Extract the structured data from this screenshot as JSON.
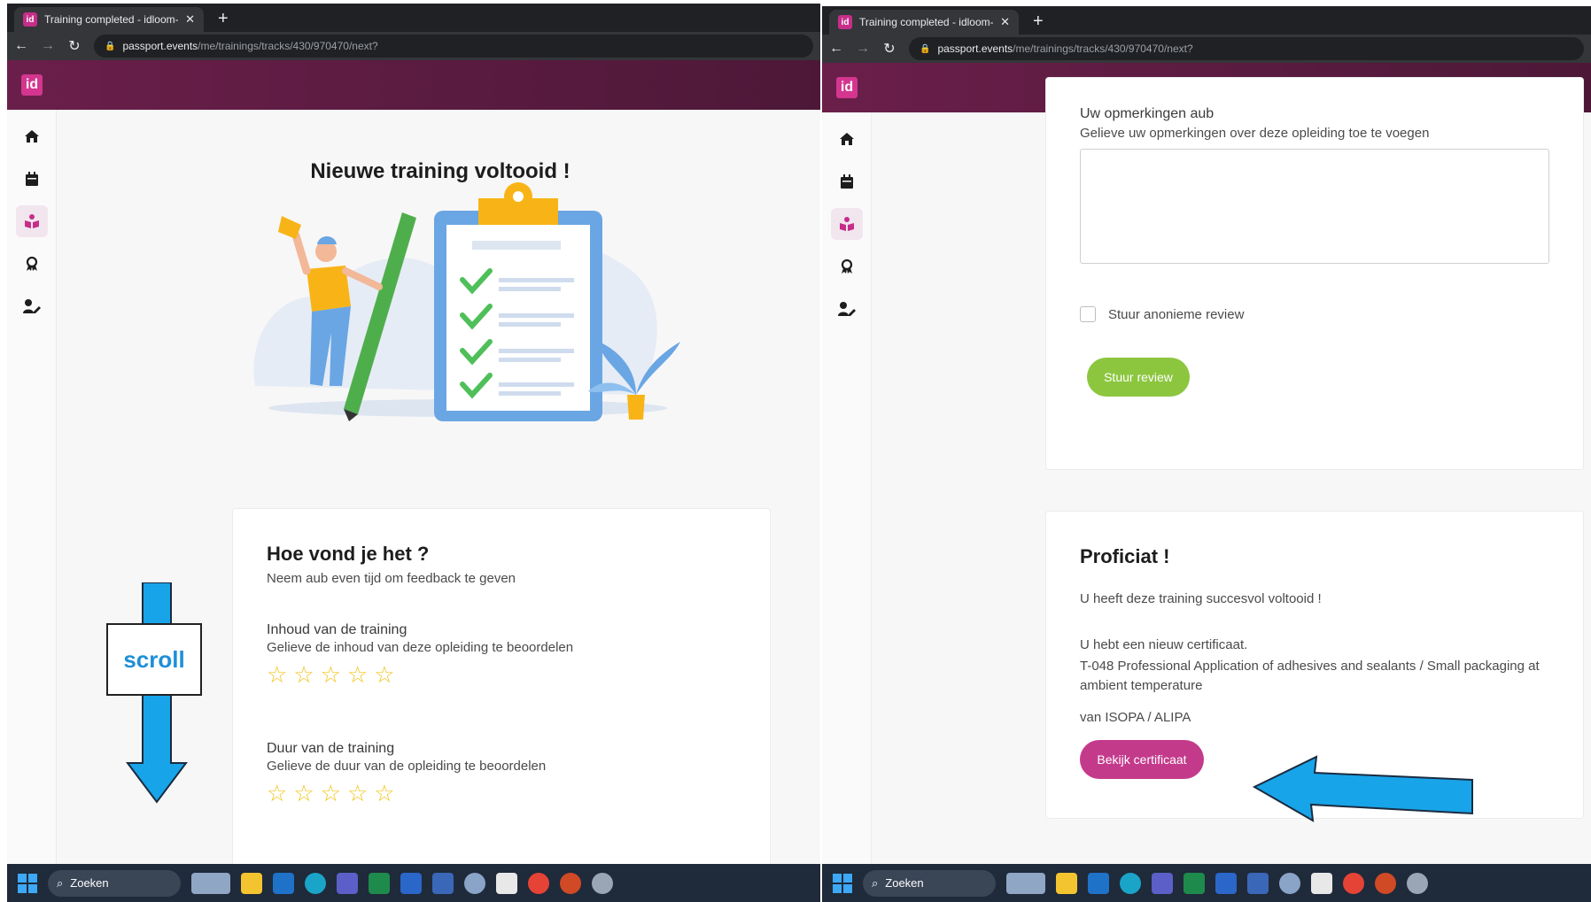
{
  "browser": {
    "tab_title": "Training completed - idloom-pas",
    "favicon_text": "id",
    "new_tab": "+",
    "close": "✕",
    "url_host": "passport.events",
    "url_path": "/me/trainings/tracks/430/970470/next?"
  },
  "app": {
    "logo_text": "id",
    "brand_color": "#c62e8a"
  },
  "left": {
    "heading": "Nieuwe training voltooid !",
    "feedback": {
      "title": "Hoe vond je het ?",
      "subtitle": "Neem aub even tijd om feedback te geven",
      "q1_label": "Inhoud van de training",
      "q1_help": "Gelieve de inhoud van deze opleiding te beoordelen",
      "q2_label": "Duur van de training",
      "q2_help": "Gelieve de duur van de opleiding te beoordelen",
      "stars": [
        "☆",
        "☆",
        "☆",
        "☆",
        "☆"
      ]
    },
    "annotation": "scroll"
  },
  "right": {
    "remarks_label": "Uw opmerkingen aub",
    "remarks_help": "Gelieve uw opmerkingen over deze opleiding toe te voegen",
    "remarks_value": "",
    "anonymous_label": "Stuur anonieme review",
    "send_button": "Stuur review",
    "congrats": {
      "title": "Proficiat !",
      "line1": "U heeft deze training succesvol voltooid !",
      "line2": "U hebt een nieuw certificaat.",
      "certificate_name": "T-048 Professional Application of adhesives and sealants / Small packaging at ambient temperature",
      "issuer": "van ISOPA / ALIPA",
      "button": "Bekijk certificaat"
    }
  },
  "taskbar": {
    "search_placeholder": "Zoeken"
  }
}
